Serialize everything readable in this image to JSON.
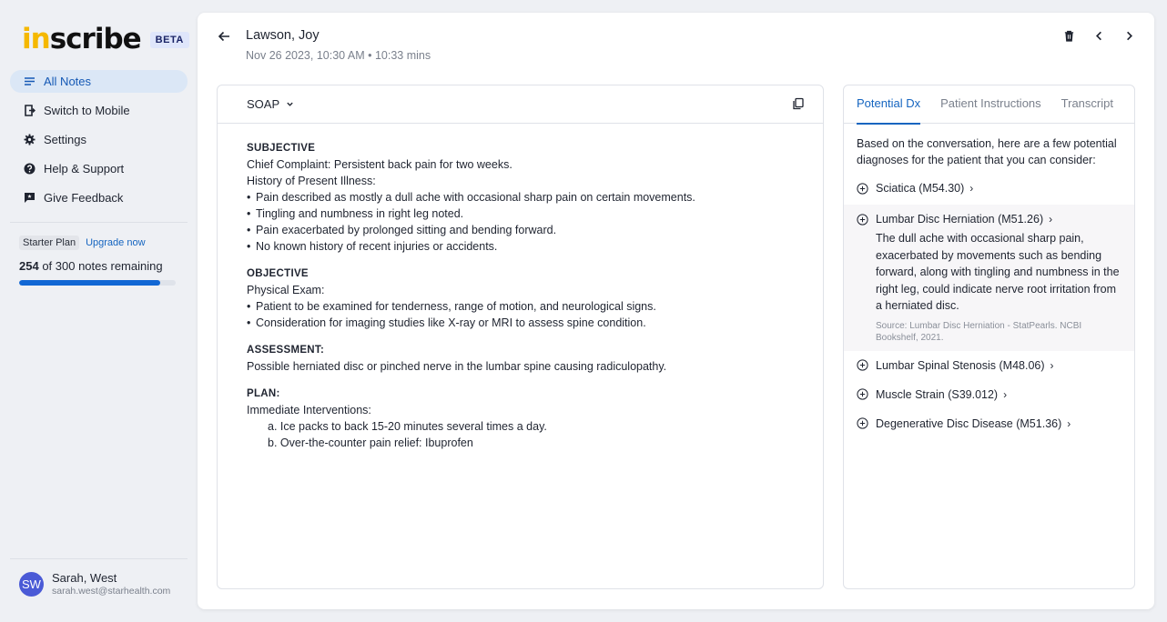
{
  "sidebar": {
    "logo_prefix": "in",
    "logo_suffix": "scribe",
    "beta": "BETA",
    "items": [
      {
        "label": "All Notes"
      },
      {
        "label": "Switch to Mobile"
      },
      {
        "label": "Settings"
      },
      {
        "label": "Help & Support"
      },
      {
        "label": "Give Feedback"
      }
    ],
    "plan": {
      "badge": "Starter Plan",
      "upgrade": "Upgrade now",
      "used": "254",
      "remaining_text": " of 300 notes remaining",
      "progress_fraction": 0.9
    },
    "user": {
      "initials": "SW",
      "name": "Sarah, West",
      "email": "sarah.west@starhealth.com"
    }
  },
  "header": {
    "patient_name": "Lawson, Joy",
    "meta": "Nov 26 2023, 10:30 AM • 10:33 mins"
  },
  "note": {
    "template": "SOAP",
    "subjective": {
      "title": "SUBJECTIVE",
      "chief": "Chief Complaint: Persistent back pain for two weeks.",
      "hpi": "History of Present Illness:",
      "bullets": [
        "Pain described as mostly a dull ache with occasional sharp pain on certain movements.",
        "Tingling and numbness in right leg noted.",
        "Pain exacerbated by prolonged sitting and bending forward.",
        "No known history of recent injuries or accidents."
      ]
    },
    "objective": {
      "title": "OBJECTIVE",
      "exam": "Physical Exam:",
      "bullets": [
        "Patient to be examined for tenderness, range of motion, and neurological signs.",
        "Consideration for imaging studies like X-ray or MRI to assess spine condition."
      ]
    },
    "assessment": {
      "title": "ASSESSMENT:",
      "text": "Possible herniated disc or pinched nerve in the lumbar spine causing radiculopathy."
    },
    "plan": {
      "title": "PLAN:",
      "intro": "Immediate Interventions:",
      "items": [
        "a. Ice packs to back 15-20 minutes several times a day.",
        "b. Over-the-counter pain relief: Ibuprofen"
      ]
    }
  },
  "dx": {
    "tabs": [
      "Potential Dx",
      "Patient Instructions",
      "Transcript"
    ],
    "intro": "Based on the conversation, here are a few potential diagnoses for the patient that you can consider:",
    "items": [
      {
        "label": "Sciatica (M54.30)"
      },
      {
        "label": "Lumbar Disc Herniation (M51.26)",
        "desc": "The dull ache with occasional sharp pain, exacerbated by movements such as bending forward, along with tingling and numbness in the right leg, could indicate nerve root irritation from a herniated disc.",
        "source": "Source: Lumbar Disc Herniation - StatPearls. NCBI Bookshelf, 2021."
      },
      {
        "label": "Lumbar Spinal Stenosis (M48.06)"
      },
      {
        "label": "Muscle Strain (S39.012)"
      },
      {
        "label": "Degenerative Disc Disease (M51.36)"
      }
    ]
  },
  "colors": {
    "accent": "#1565c0",
    "logo_yellow": "#f5b800",
    "avatar": "#4a5ad6"
  }
}
